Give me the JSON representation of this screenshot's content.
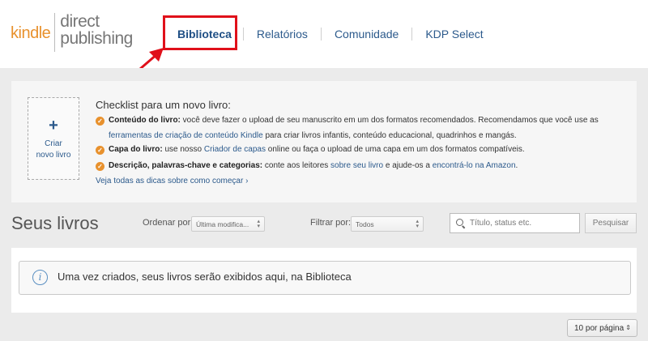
{
  "logo": {
    "kindle": "kindle",
    "direct": "direct",
    "publishing": "publishing"
  },
  "nav": {
    "items": [
      {
        "label": "Biblioteca"
      },
      {
        "label": "Relatórios"
      },
      {
        "label": "Comunidade"
      },
      {
        "label": "KDP Select"
      }
    ]
  },
  "create": {
    "plus": "+",
    "line1": "Criar",
    "line2": "novo livro"
  },
  "checklist": {
    "title": "Checklist para um novo livro:",
    "items": [
      {
        "bold": "Conteúdo do livro:",
        "text1": " você deve fazer o upload de seu manuscrito em um dos formatos recomendados. Recomendamos que você use as",
        "link": "ferramentas de criação de conteúdo Kindle",
        "text2": " para criar livros infantis, conteúdo educacional, quadrinhos e mangás."
      },
      {
        "bold": "Capa do livro:",
        "text1": " use nosso ",
        "link": "Criador de capas",
        "text2": " online ou faça o upload de uma capa em um dos formatos compatíveis."
      },
      {
        "bold": "Descrição, palavras-chave e categorias:",
        "text1": " conte aos leitores ",
        "link": "sobre seu livro",
        "text2": " e ajude-os a ",
        "link2": "encontrá-lo na Amazon",
        "text3": "."
      }
    ],
    "see_all": "Veja todas as dicas sobre como começar ›"
  },
  "books": {
    "title": "Seus livros",
    "sort_label": "Ordenar por:",
    "sort_value": "Última modifica...",
    "filter_label": "Filtrar por:",
    "filter_value": "Todos",
    "search_placeholder": "Título, status etc.",
    "search_button": "Pesquisar",
    "empty_message": "Uma vez criados, seus livros serão exibidos aqui, na Biblioteca",
    "info_icon_glyph": "i",
    "per_page": "10 por página"
  },
  "icons": {
    "search": "search-icon",
    "info": "info-icon",
    "check": "check-circle-icon",
    "plus": "plus-icon",
    "annotation": "red-arrow"
  },
  "colors": {
    "accent": "#e8912d",
    "link": "#2c5a8c",
    "highlight": "#e0101a"
  }
}
